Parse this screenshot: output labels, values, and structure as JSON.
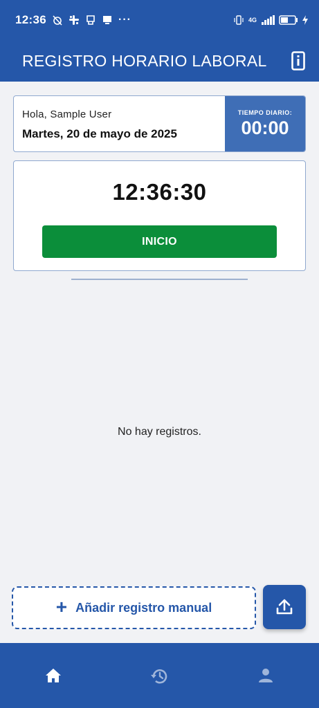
{
  "status_bar": {
    "time": "12:36",
    "network": "4G",
    "battery": "38"
  },
  "app_bar": {
    "title": "REGISTRO HORARIO LABORAL"
  },
  "greeting": {
    "hello": "Hola, Sample User",
    "date": "Martes, 20 de mayo de 2025",
    "daily_label": "TIEMPO DIARIO:",
    "daily_value": "00:00"
  },
  "clock": {
    "time": "12:36:30",
    "start_label": "INICIO"
  },
  "records": {
    "empty_text": "No hay registros."
  },
  "actions": {
    "manual_label": "Añadir registro manual",
    "manual_icon": "plus-icon",
    "upload_icon": "upload-icon"
  },
  "bottom_nav": {
    "items": [
      {
        "icon": "home-icon",
        "active": true
      },
      {
        "icon": "history-icon",
        "active": false
      },
      {
        "icon": "person-icon",
        "active": false
      }
    ]
  },
  "colors": {
    "primary": "#2557a9",
    "daily_box": "#3f6eb6",
    "start_button": "#0b8e3a",
    "background": "#f1f2f5"
  }
}
